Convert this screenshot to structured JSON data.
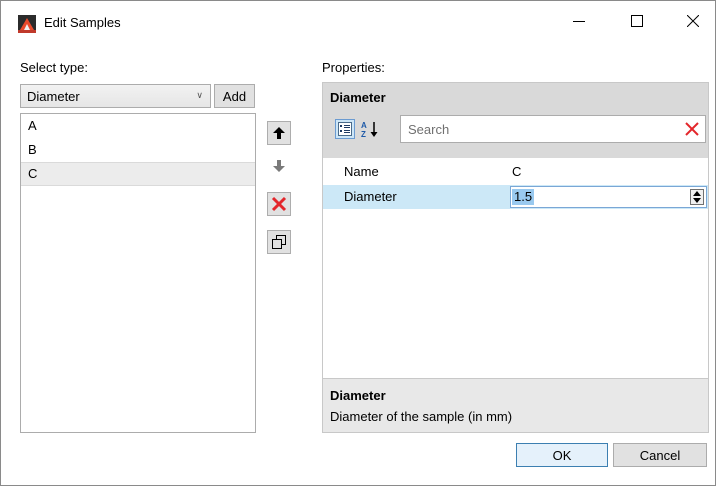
{
  "window": {
    "title": "Edit Samples",
    "app_icon": "mountain-app-icon",
    "controls": {
      "minimize": "minimize-icon",
      "maximize": "maximize-icon",
      "close": "close-icon"
    }
  },
  "left_panel": {
    "label": "Select type:",
    "type_select": {
      "value": "Diameter",
      "icon": "chevron-down-icon"
    },
    "add_label": "Add",
    "items": [
      {
        "label": "A",
        "selected": false
      },
      {
        "label": "B",
        "selected": false
      },
      {
        "label": "C",
        "selected": true
      }
    ]
  },
  "tools": {
    "move_up": "arrow-up-icon",
    "move_down": "arrow-down-icon",
    "delete": "delete-x-icon",
    "duplicate": "copy-icon"
  },
  "properties": {
    "label": "Properties:",
    "object_title": "Diameter",
    "search_placeholder": "Search",
    "rows": [
      {
        "name": "Name",
        "value": "C"
      },
      {
        "name": "Diameter",
        "value": "1.5"
      }
    ],
    "description_title": "Diameter",
    "description_text": "Diameter of the sample (in mm)"
  },
  "footer": {
    "ok_label": "OK",
    "cancel_label": "Cancel"
  },
  "colors": {
    "selection": "#cce8f7",
    "delete_red": "#e3262b",
    "accent_border": "#3c7fb1"
  }
}
